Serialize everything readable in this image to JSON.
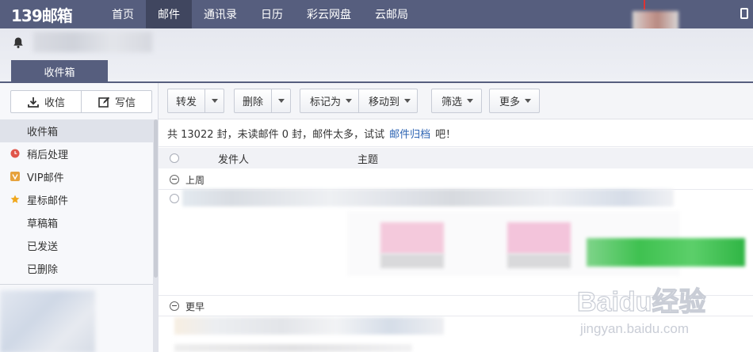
{
  "logo": "139邮箱",
  "nav": [
    "首页",
    "邮件",
    "通讯录",
    "日历",
    "彩云网盘",
    "云邮局"
  ],
  "nav_active": 1,
  "inbox_tab": "收件箱",
  "compose": {
    "receive": "收信",
    "write": "写信"
  },
  "folders": [
    {
      "label": "收件箱",
      "icon": ""
    },
    {
      "label": "稍后处理",
      "icon": "clock-icon"
    },
    {
      "label": "VIP邮件",
      "icon": "vip-icon"
    },
    {
      "label": "星标邮件",
      "icon": "star-icon"
    },
    {
      "label": "草稿箱",
      "icon": ""
    },
    {
      "label": "已发送",
      "icon": ""
    },
    {
      "label": "已删除",
      "icon": ""
    }
  ],
  "toolbar": {
    "forward": "转发",
    "delete": "删除",
    "mark_as": "标记为",
    "move_to": "移动到",
    "filter": "筛选",
    "more": "更多"
  },
  "info": {
    "text": "共 13022 封，未读邮件 0 封，邮件太多，试试",
    "link": "邮件归档",
    "suffix": "吧！"
  },
  "list_header": {
    "sender": "发件人",
    "subject": "主题"
  },
  "groups": {
    "last_week": "上周",
    "earlier": "更早"
  },
  "watermark": {
    "brand": "Baidu经验",
    "url": "jingyan.baidu.com"
  },
  "colors": {
    "nav_bg": "#565e7e",
    "nav_active": "#40465f",
    "link": "#2d64b3"
  }
}
